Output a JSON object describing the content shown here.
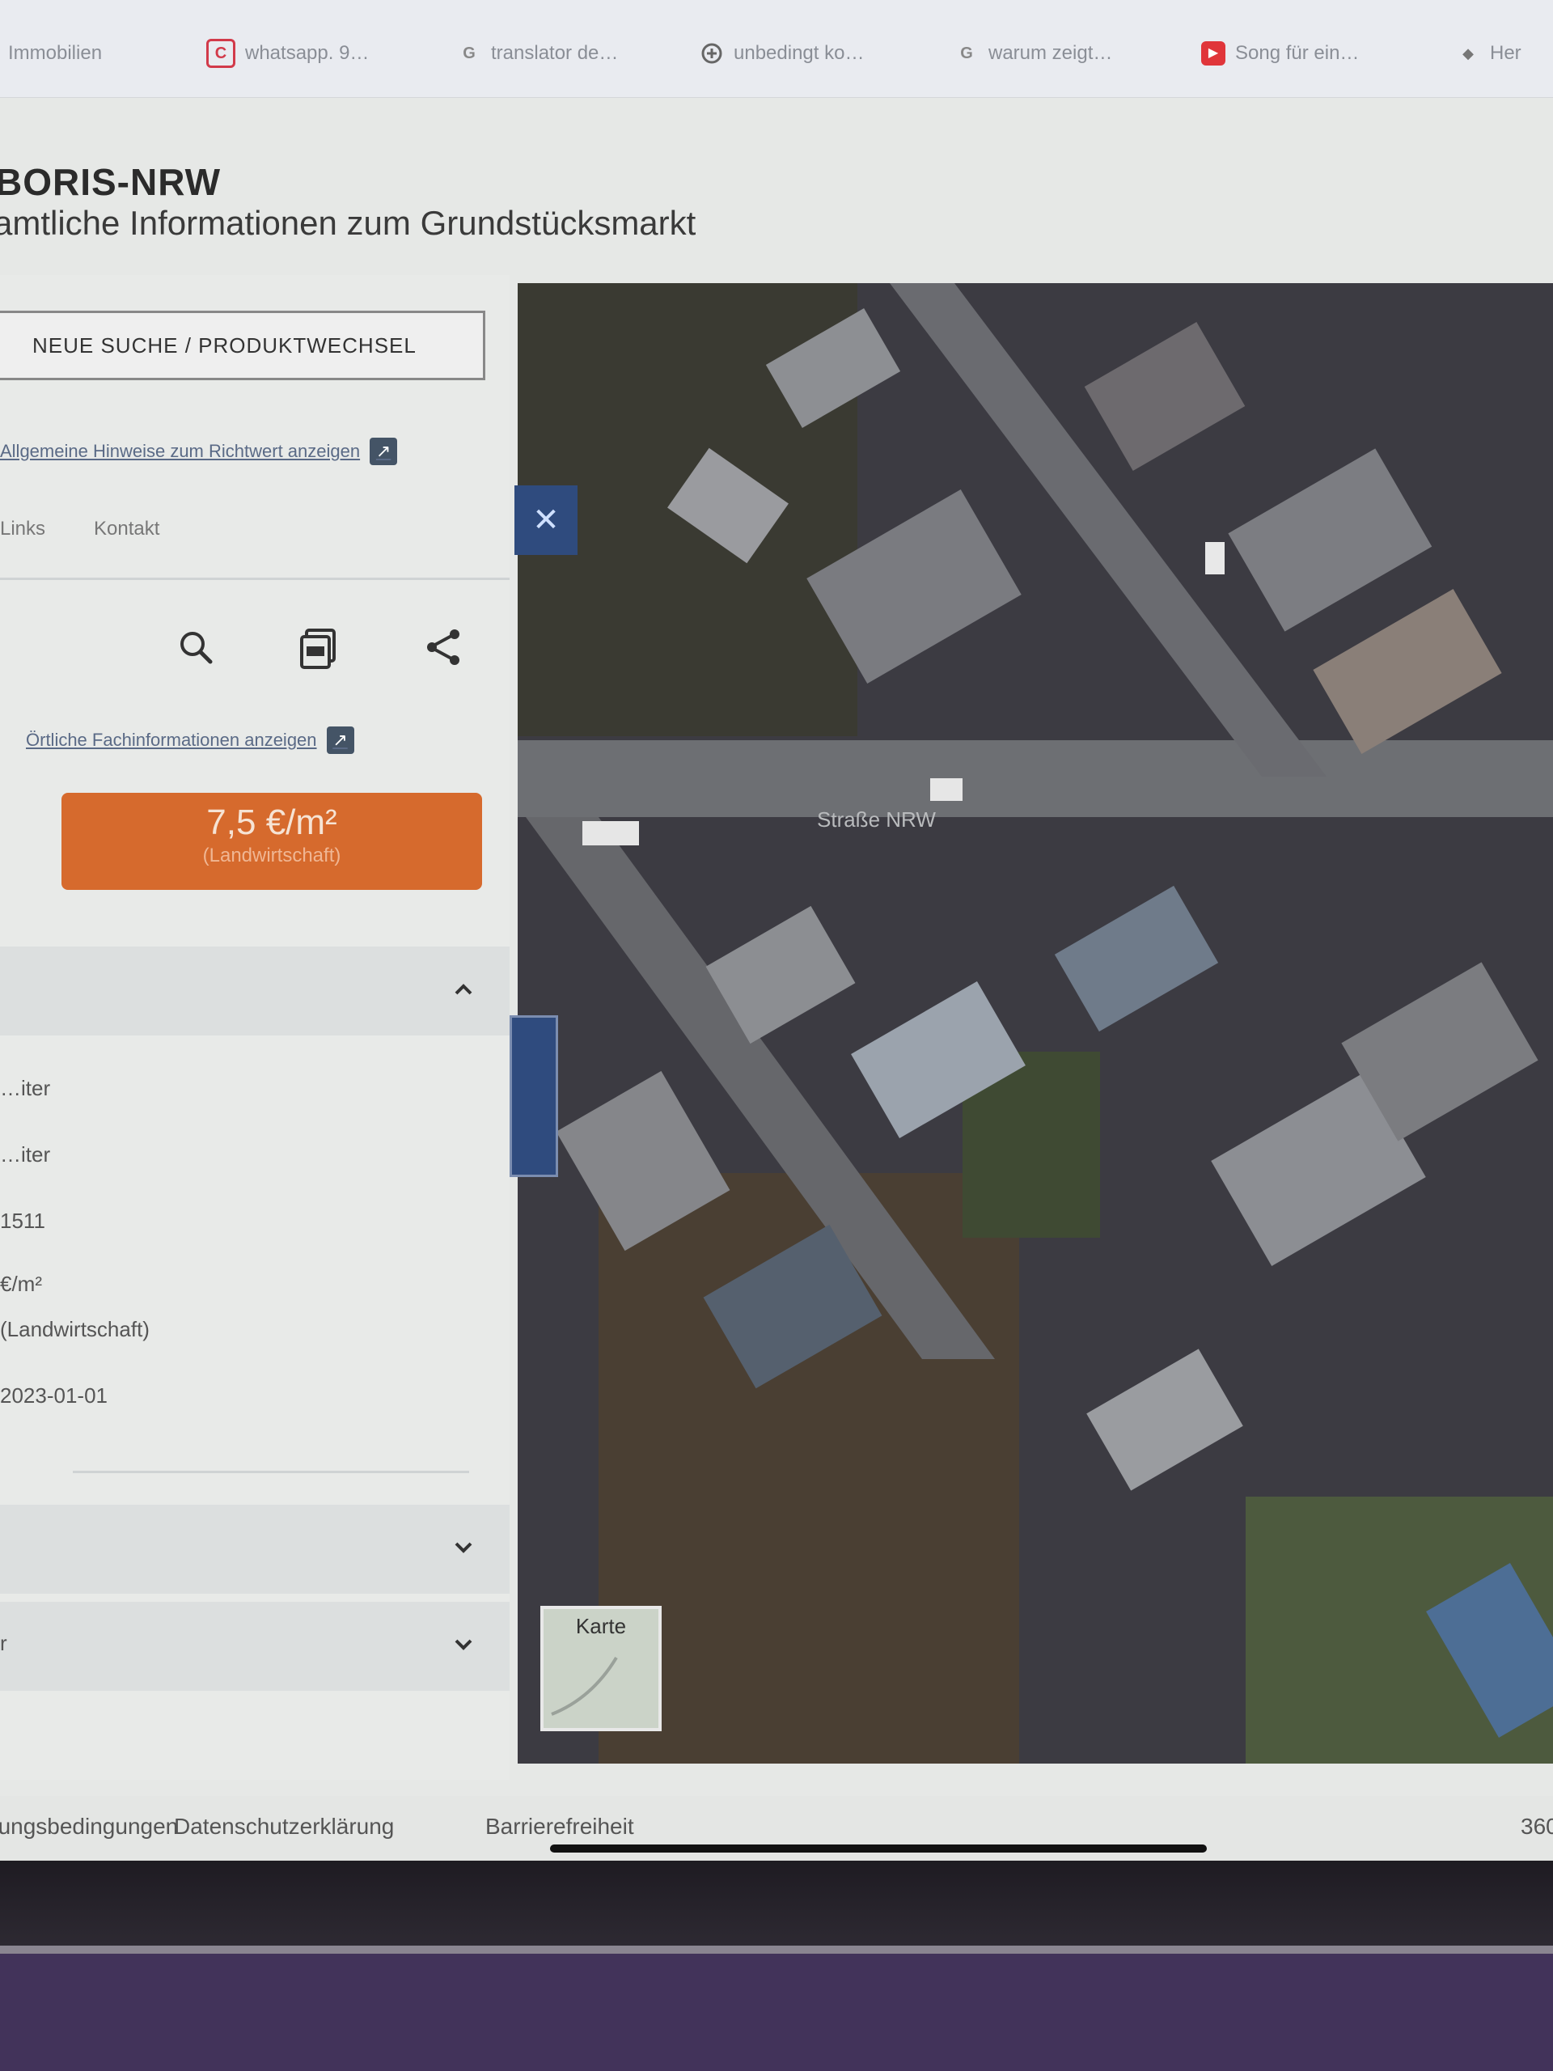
{
  "bookmarks": [
    {
      "label": "Immobilien",
      "icon": "",
      "color": "#888888"
    },
    {
      "label": "whatsapp. 9…",
      "icon": "C",
      "color": "#d23a4a"
    },
    {
      "label": "translator de…",
      "icon": "G",
      "color": "#888888"
    },
    {
      "label": "unbedingt ko…",
      "icon": "",
      "color": "#666666"
    },
    {
      "label": "warum zeigt…",
      "icon": "G",
      "color": "#888888"
    },
    {
      "label": "Song für ein…",
      "icon": "▶",
      "color": "#e0353a"
    },
    {
      "label": "Her",
      "icon": "",
      "color": "#888888"
    }
  ],
  "header": {
    "title": "BORIS-NRW",
    "subtitle": "amtliche Informationen zum Grundstücksmarkt"
  },
  "panel": {
    "new_search_label": "NEUE SUCHE / PRODUKTWECHSEL",
    "hint_link": "Allgemeine Hinweise zum Richtwert anzeigen",
    "nav": [
      "Links",
      "Kontakt"
    ],
    "local_info_link": "Örtliche Fachinformationen anzeigen",
    "value": "7,5 €/m²",
    "value_sub": "(Landwirtschaft)",
    "details": [
      "…iter",
      "…iter",
      "1511",
      "€/m²",
      "(Landwirtschaft)",
      "2023-01-01"
    ],
    "accordion2_label": "",
    "accordion3_label": "r"
  },
  "map": {
    "street_label": "Straße NRW",
    "layer_switch_label": "Karte"
  },
  "footer": {
    "links": [
      "Nutzungsbedingungen",
      "Datenschutzerklärung",
      "Barrierefreiheit"
    ],
    "right_text": "360"
  },
  "colors": {
    "accent_orange": "#d66a2d",
    "map_control_blue": "#2f4b7e"
  }
}
